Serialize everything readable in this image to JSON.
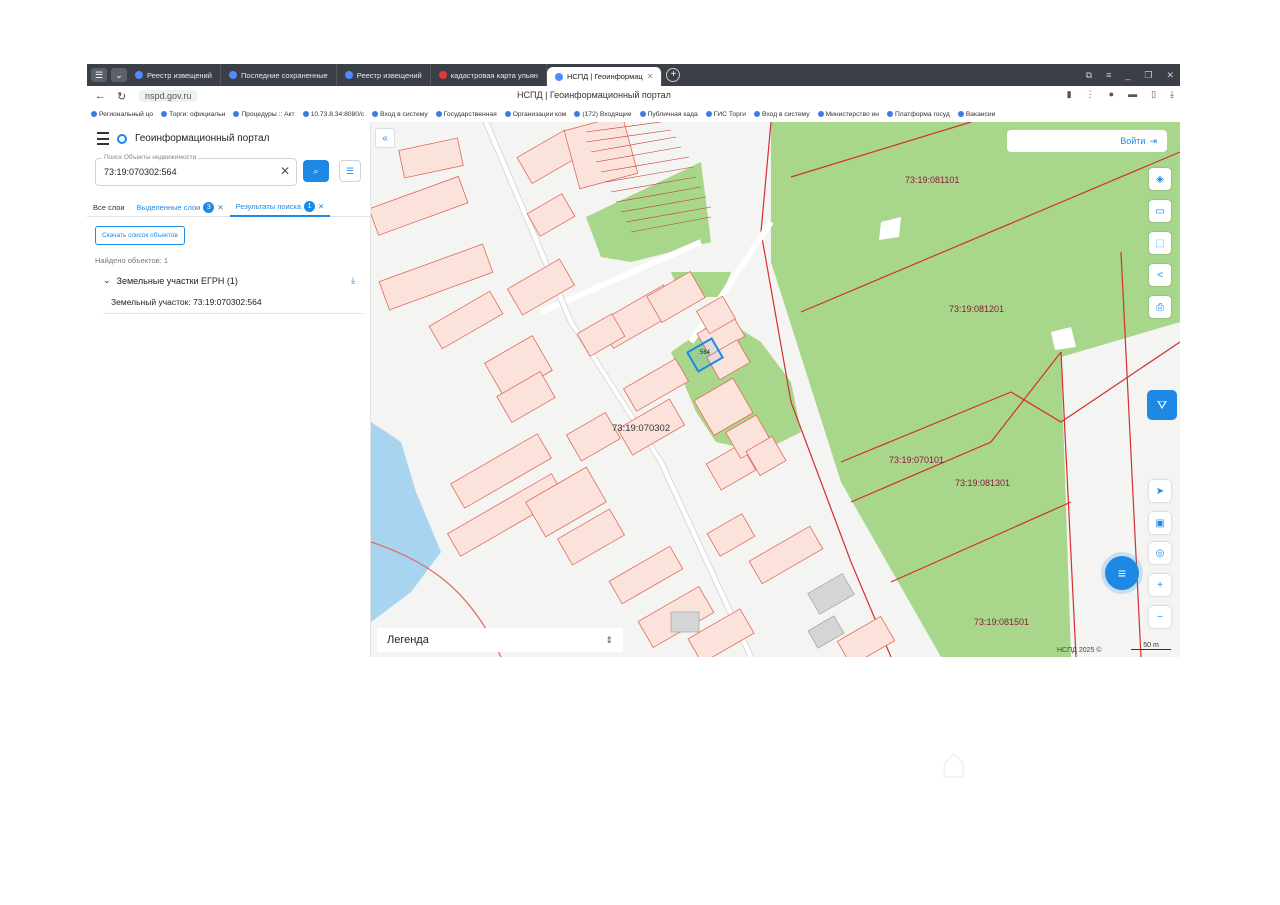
{
  "browser": {
    "tabs": [
      {
        "label": "Реестр извещений",
        "active": false
      },
      {
        "label": "Последние сохраненные",
        "active": false
      },
      {
        "label": "Реестр извещений",
        "active": false
      },
      {
        "label": "кадастровая карта ульян",
        "active": false
      },
      {
        "label": "НСПД | Геоинформац",
        "active": true
      }
    ],
    "url": "nspd.gov.ru",
    "page_title": "НСПД | Геоинформационный портал",
    "bookmarks": [
      "Региональный цо",
      "Торги: официальн",
      "Процедуры :: Акт",
      "10.73.8.34:8080/c",
      "Вход в систему",
      "Государственная",
      "Организации ком",
      "(172) Входящие",
      "Публичная када",
      "ГИС Торги",
      "Вход в систему",
      "Министерство ин",
      "Платформа госуд",
      "Вакансии"
    ]
  },
  "panel": {
    "title": "Геоинформационный портал",
    "search_label": "Поиск Объекты недвижимости",
    "search_value": "73:19:070302:564",
    "tabs": [
      {
        "label": "Все слои",
        "badge": ""
      },
      {
        "label": "Выделенные слои",
        "badge": "3"
      },
      {
        "label": "Результаты поиска",
        "badge": "1"
      }
    ],
    "download_label": "Скачать список объектов",
    "found_text": "Найдено объектов: 1",
    "group_label": "Земельные участки ЕГРН (1)",
    "result_label": "Земельный участок: 73:19:070302:564"
  },
  "map": {
    "login_label": "Войти",
    "legend_label": "Легенда",
    "copyright": "НСПД 2025 ©",
    "scale": "50 m",
    "quarters": [
      "73:19:081101",
      "73:19:081201",
      "73:19:070101",
      "73:19:081301",
      "73:19:081501",
      "73:19:070302"
    ],
    "selected_parcel": "564",
    "colors": {
      "forest": "#a8d78c",
      "parcel_fill": "#fbe3dc",
      "parcel_stroke": "#e06a5a",
      "quarter_label": "#8b1a3a",
      "selected": "#1e88e5"
    }
  }
}
